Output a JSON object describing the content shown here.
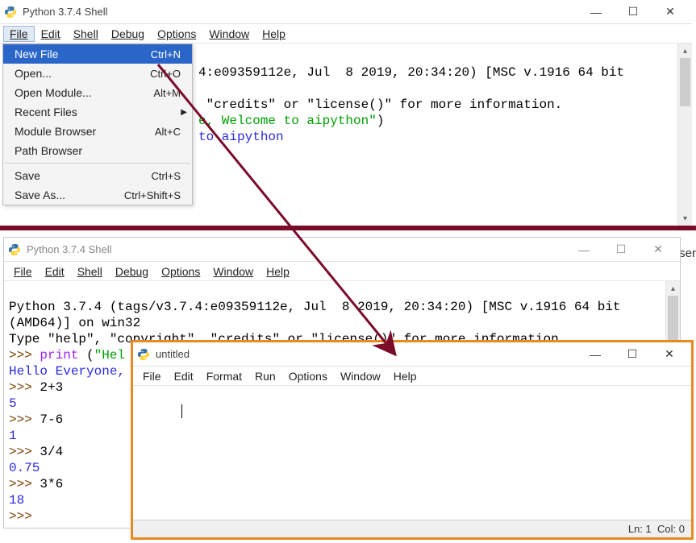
{
  "win1": {
    "title": "Python 3.7.4 Shell",
    "menubar": [
      "File",
      "Edit",
      "Shell",
      "Debug",
      "Options",
      "Window",
      "Help"
    ],
    "dropdown": {
      "items": [
        {
          "label": "New File",
          "shortcut": "Ctrl+N",
          "selected": true
        },
        {
          "label": "Open...",
          "shortcut": "Ctrl+O"
        },
        {
          "label": "Open Module...",
          "shortcut": "Alt+M"
        },
        {
          "label": "Recent Files",
          "shortcut": "",
          "submenu": true
        },
        {
          "label": "Module Browser",
          "shortcut": "Alt+C"
        },
        {
          "label": "Path Browser",
          "shortcut": ""
        },
        {
          "label": "Save",
          "shortcut": "Ctrl+S"
        },
        {
          "label": "Save As...",
          "shortcut": "Ctrl+Shift+S"
        }
      ]
    },
    "visible_text": {
      "line1_fragment": "4:e09359112e, Jul  8 2019, 20:34:20) [MSC v.1916 64 bit",
      "line2_fragment": " \"credits\" or \"license()\" for more information.",
      "line3_str_fragment": "e, Welcome to aipython\"",
      "line3_paren": ")",
      "line4_out_fragment": "to aipython"
    }
  },
  "win2": {
    "title": "Python 3.7.4 Shell",
    "menubar": [
      "File",
      "Edit",
      "Shell",
      "Debug",
      "Options",
      "Window",
      "Help"
    ],
    "content": {
      "header1": "Python 3.7.4 (tags/v3.7.4:e09359112e, Jul  8 2019, 20:34:20) [MSC v.1916 64 bit",
      "header2": "(AMD64)] on win32",
      "header3": "Type \"help\", \"copyright\", \"credits\" or \"license()\" for more information.",
      "lines": [
        {
          "prompt": ">>> ",
          "kw": "print",
          "plain_after_kw": " (",
          "str": "\"Hel",
          "rest": ""
        },
        {
          "out": "Hello Everyone,"
        },
        {
          "prompt": ">>> ",
          "plain": "2+3"
        },
        {
          "out": "5"
        },
        {
          "prompt": ">>> ",
          "plain": "7-6"
        },
        {
          "out": "1"
        },
        {
          "prompt": ">>> ",
          "plain": "3/4"
        },
        {
          "out": "0.75"
        },
        {
          "prompt": ">>> ",
          "plain": "3*6"
        },
        {
          "out": "18"
        },
        {
          "prompt": ">>> ",
          "plain": ""
        }
      ]
    }
  },
  "win3": {
    "title": "untitled",
    "menubar": [
      "File",
      "Edit",
      "Format",
      "Run",
      "Options",
      "Window",
      "Help"
    ],
    "status": {
      "ln": "Ln: 1",
      "col": "Col: 0"
    }
  },
  "truncated_text": "ser",
  "icons": {
    "minimize": "—",
    "maximize": "☐",
    "close": "✕",
    "submenu": "▶",
    "up": "▴",
    "down": "▾"
  }
}
